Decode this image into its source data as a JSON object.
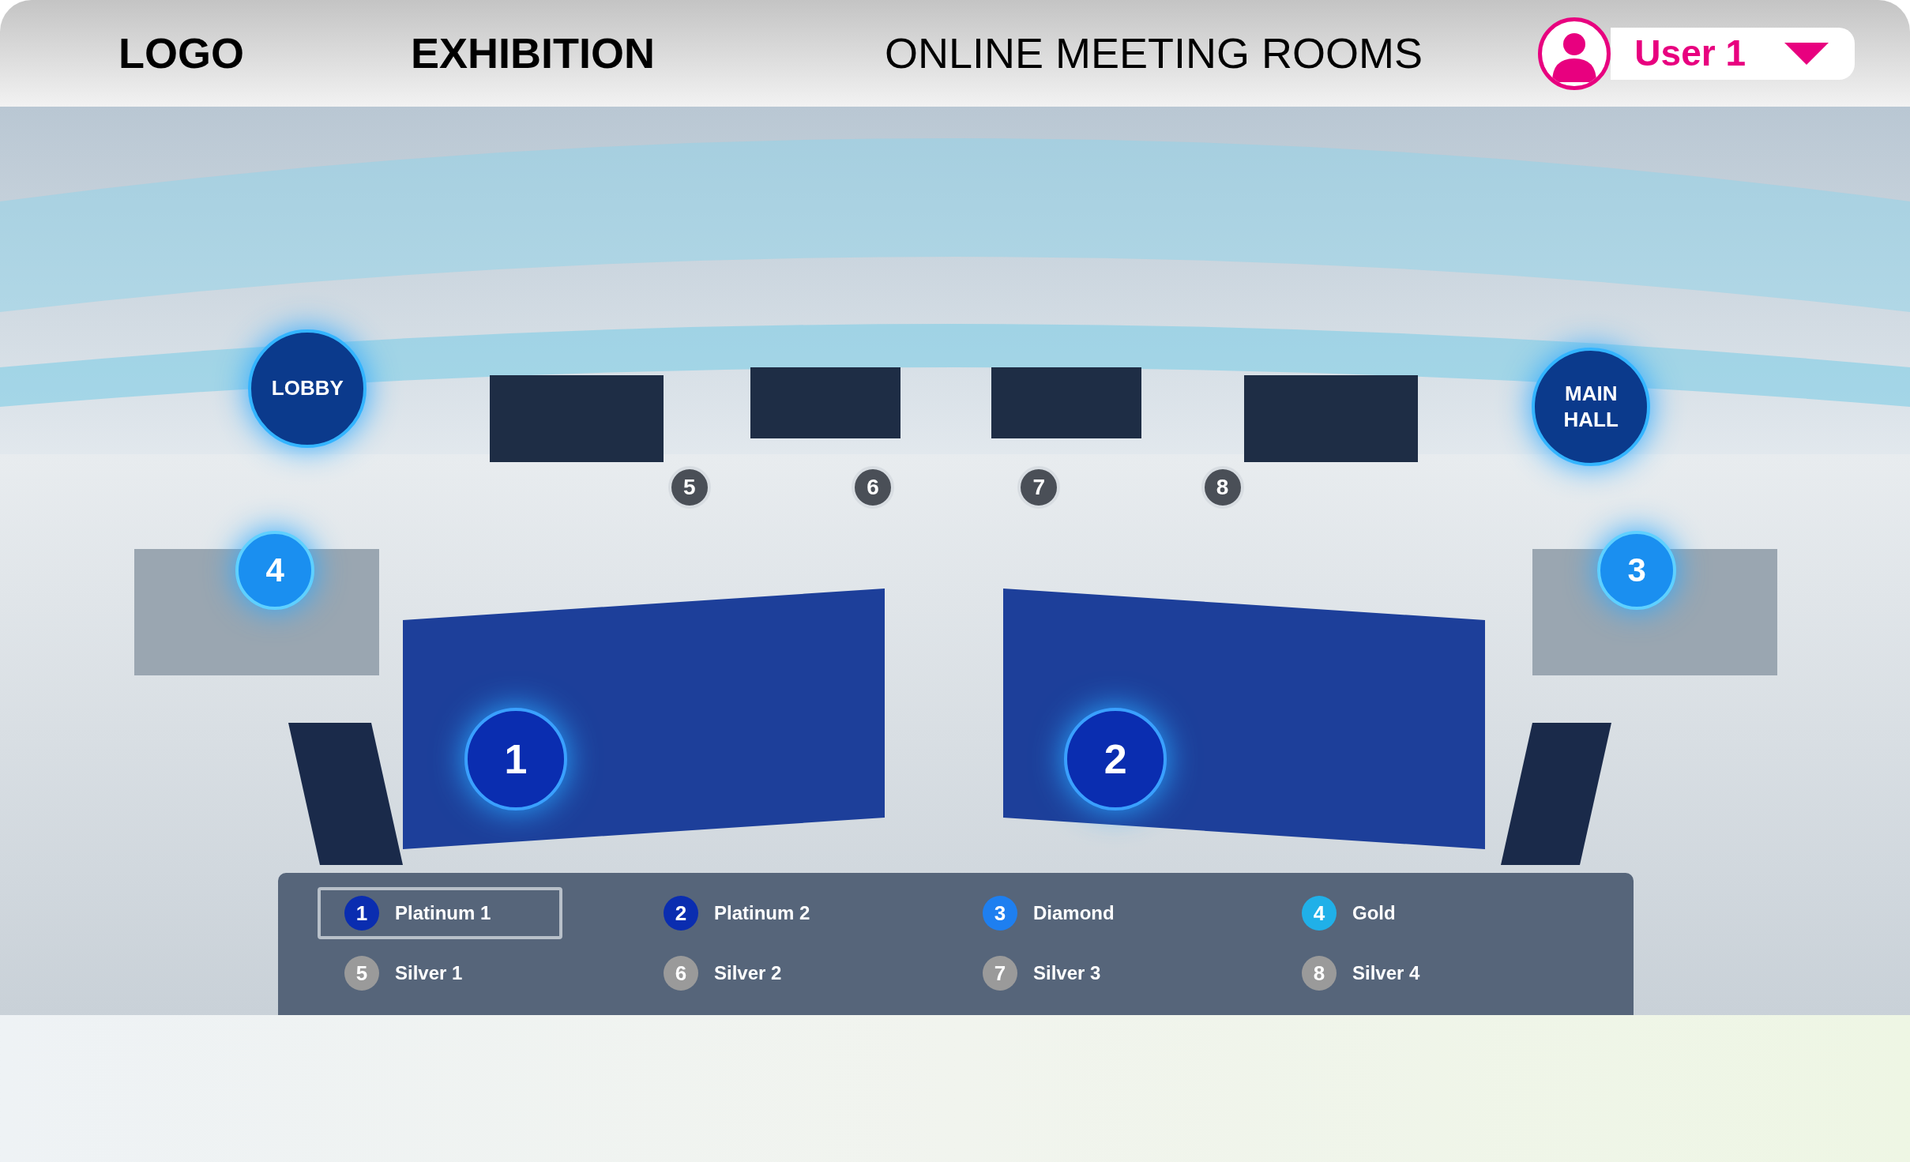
{
  "header": {
    "logo": "LOGO",
    "nav": [
      {
        "label": "EXHIBITION",
        "selected": true
      },
      {
        "label": "ONLINE MEETING ROOMS",
        "selected": false
      }
    ],
    "user": {
      "name": "User 1"
    }
  },
  "scene": {
    "hotspots": [
      {
        "label": "LOBBY",
        "kind": "area"
      },
      {
        "label": "MAIN HALL",
        "kind": "area"
      },
      {
        "label": "4",
        "kind": "booth"
      },
      {
        "label": "3",
        "kind": "booth"
      },
      {
        "label": "1",
        "kind": "large"
      },
      {
        "label": "2",
        "kind": "large"
      },
      {
        "label": "5",
        "kind": "small"
      },
      {
        "label": "6",
        "kind": "small"
      },
      {
        "label": "7",
        "kind": "small"
      },
      {
        "label": "8",
        "kind": "small"
      }
    ]
  },
  "legend": [
    {
      "number": "1",
      "label": "Platinum 1",
      "color": "#0a2db0",
      "selected": true
    },
    {
      "number": "2",
      "label": "Platinum 2",
      "color": "#0a2db0",
      "selected": false
    },
    {
      "number": "3",
      "label": "Diamond",
      "color": "#1e7ff0",
      "selected": false
    },
    {
      "number": "4",
      "label": "Gold",
      "color": "#20b0e8",
      "selected": false
    },
    {
      "number": "5",
      "label": "Silver 1",
      "color": "#9a9a9a",
      "selected": false
    },
    {
      "number": "6",
      "label": "Silver 2",
      "color": "#9a9a9a",
      "selected": false
    },
    {
      "number": "7",
      "label": "Silver 3",
      "color": "#9a9a9a",
      "selected": false
    },
    {
      "number": "8",
      "label": "Silver 4",
      "color": "#9a9a9a",
      "selected": false
    }
  ]
}
